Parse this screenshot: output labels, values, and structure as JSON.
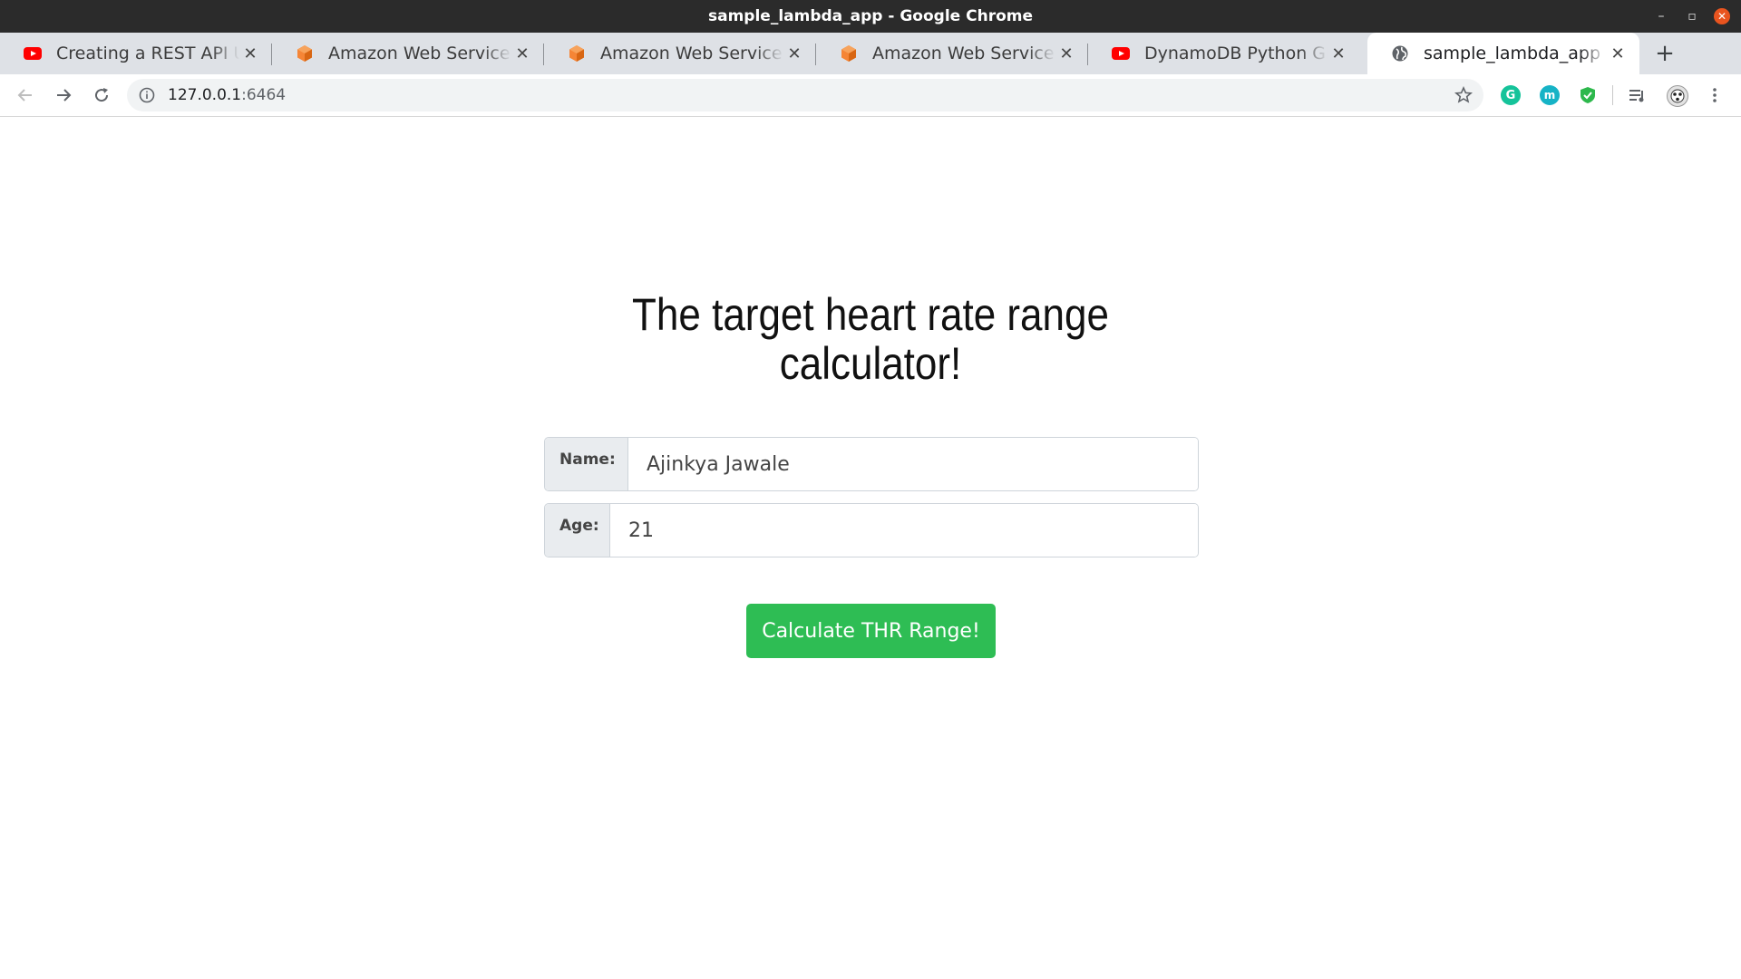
{
  "window": {
    "title": "sample_lambda_app - Google Chrome",
    "controls": {
      "minimize": "–",
      "maximize": "▫",
      "close": "✕"
    }
  },
  "tabs": [
    {
      "label": "Creating a REST API Using",
      "favicon": "youtube-icon",
      "active": false
    },
    {
      "label": "Amazon Web Services Sign",
      "favicon": "aws-icon",
      "active": false
    },
    {
      "label": "Amazon Web Services Sign",
      "favicon": "aws-icon",
      "active": false
    },
    {
      "label": "Amazon Web Services Sign",
      "favicon": "aws-icon",
      "active": false
    },
    {
      "label": "DynamoDB Python GET PUT",
      "favicon": "youtube-icon",
      "active": false
    },
    {
      "label": "sample_lambda_app",
      "favicon": "globe-icon",
      "active": true
    }
  ],
  "new_tab_label": "+",
  "address_bar": {
    "host": "127.0.0.1",
    "port": ":6464"
  },
  "extensions": {
    "grammarly": "G",
    "m": "m"
  },
  "page": {
    "heading_line1": "The target heart rate range",
    "heading_line2": "calculator!",
    "name_label": "Name:",
    "name_value": "Ajinkya Jawale",
    "age_label": "Age:",
    "age_value": "21",
    "submit_label": "Calculate THR Range!"
  },
  "colors": {
    "button": "#2ebd54",
    "titlebar": "#2b2b2b",
    "tabstrip": "#dee1e6",
    "close_button": "#e9541f"
  }
}
